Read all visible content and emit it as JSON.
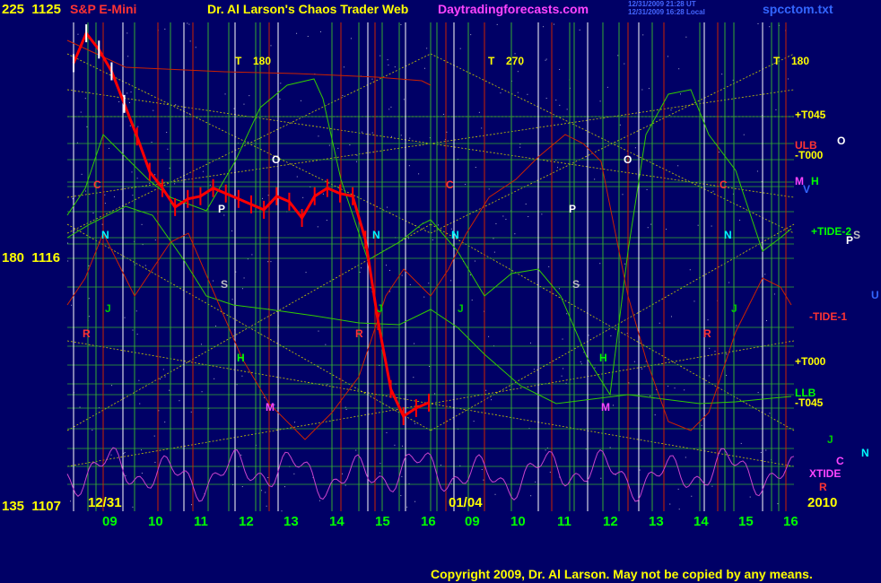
{
  "header": {
    "symbol": "S&P E-Mini",
    "title": "Dr. Al Larson's Chaos Trader Web",
    "site": "Daytradingforecasts.com",
    "file": "spcctom.txt",
    "stamp1": "12/31/2009 21:28 UT",
    "stamp2": "12/31/2009 16:28 Local"
  },
  "footer": {
    "copyright": "Copyright 2009, Dr. Al Larson. May not be copied by any means."
  },
  "colors": {
    "background": "#000066",
    "price": "#ffffff",
    "price_red": "#ff0000",
    "grid_green": "#33aa33",
    "yellow_grid": "#cccc00",
    "red_line": "#cc2200",
    "green_line": "#33cc00",
    "magenta_line": "#cc44cc"
  },
  "chart_data": {
    "type": "line",
    "y_axis_labels": [
      {
        "deg": "225",
        "price": "1125"
      },
      {
        "deg": "180",
        "price": "1116"
      },
      {
        "deg": "135",
        "price": "1107"
      }
    ],
    "ylim": [
      1107,
      1125
    ],
    "x_day_labels": [
      "09",
      "10",
      "11",
      "12",
      "13",
      "14",
      "15",
      "16",
      "09",
      "10",
      "11",
      "12",
      "13",
      "14",
      "15",
      "16"
    ],
    "date_labels": [
      "12/31",
      "01/04",
      "2010"
    ],
    "series": [
      {
        "values": [
          1123.5,
          1124.6,
          1124.0,
          1123.2,
          1122.0,
          1120.8,
          1119.5,
          1118.9,
          1118.2,
          1118.5,
          1118.6,
          1118.9,
          1118.7,
          1118.5,
          1118.3,
          1118.1,
          1118.6,
          1118.4,
          1117.8,
          1118.6,
          1118.9,
          1118.7,
          1118.6,
          1117.0,
          1114.0,
          1111.5,
          1110.5,
          1110.8,
          1111.0
        ]
      }
    ],
    "right_labels": [
      "+T045",
      "ULB",
      "-T000",
      "M",
      "H",
      "V",
      "+TIDE-2",
      "S",
      "P",
      "-TIDE-1",
      "+T000",
      "LLB",
      "-T045",
      "J",
      "N",
      "C",
      "XTIDE",
      "R",
      "U",
      "O"
    ],
    "chart_letters": [
      "T",
      "180",
      "T",
      "270",
      "T",
      "180",
      "O",
      "O",
      "P",
      "P",
      "S",
      "S",
      "N",
      "N",
      "N",
      "N",
      "J",
      "J",
      "J",
      "J",
      "R",
      "R",
      "R",
      "H",
      "H",
      "M",
      "M",
      "C",
      "C",
      "C"
    ]
  }
}
